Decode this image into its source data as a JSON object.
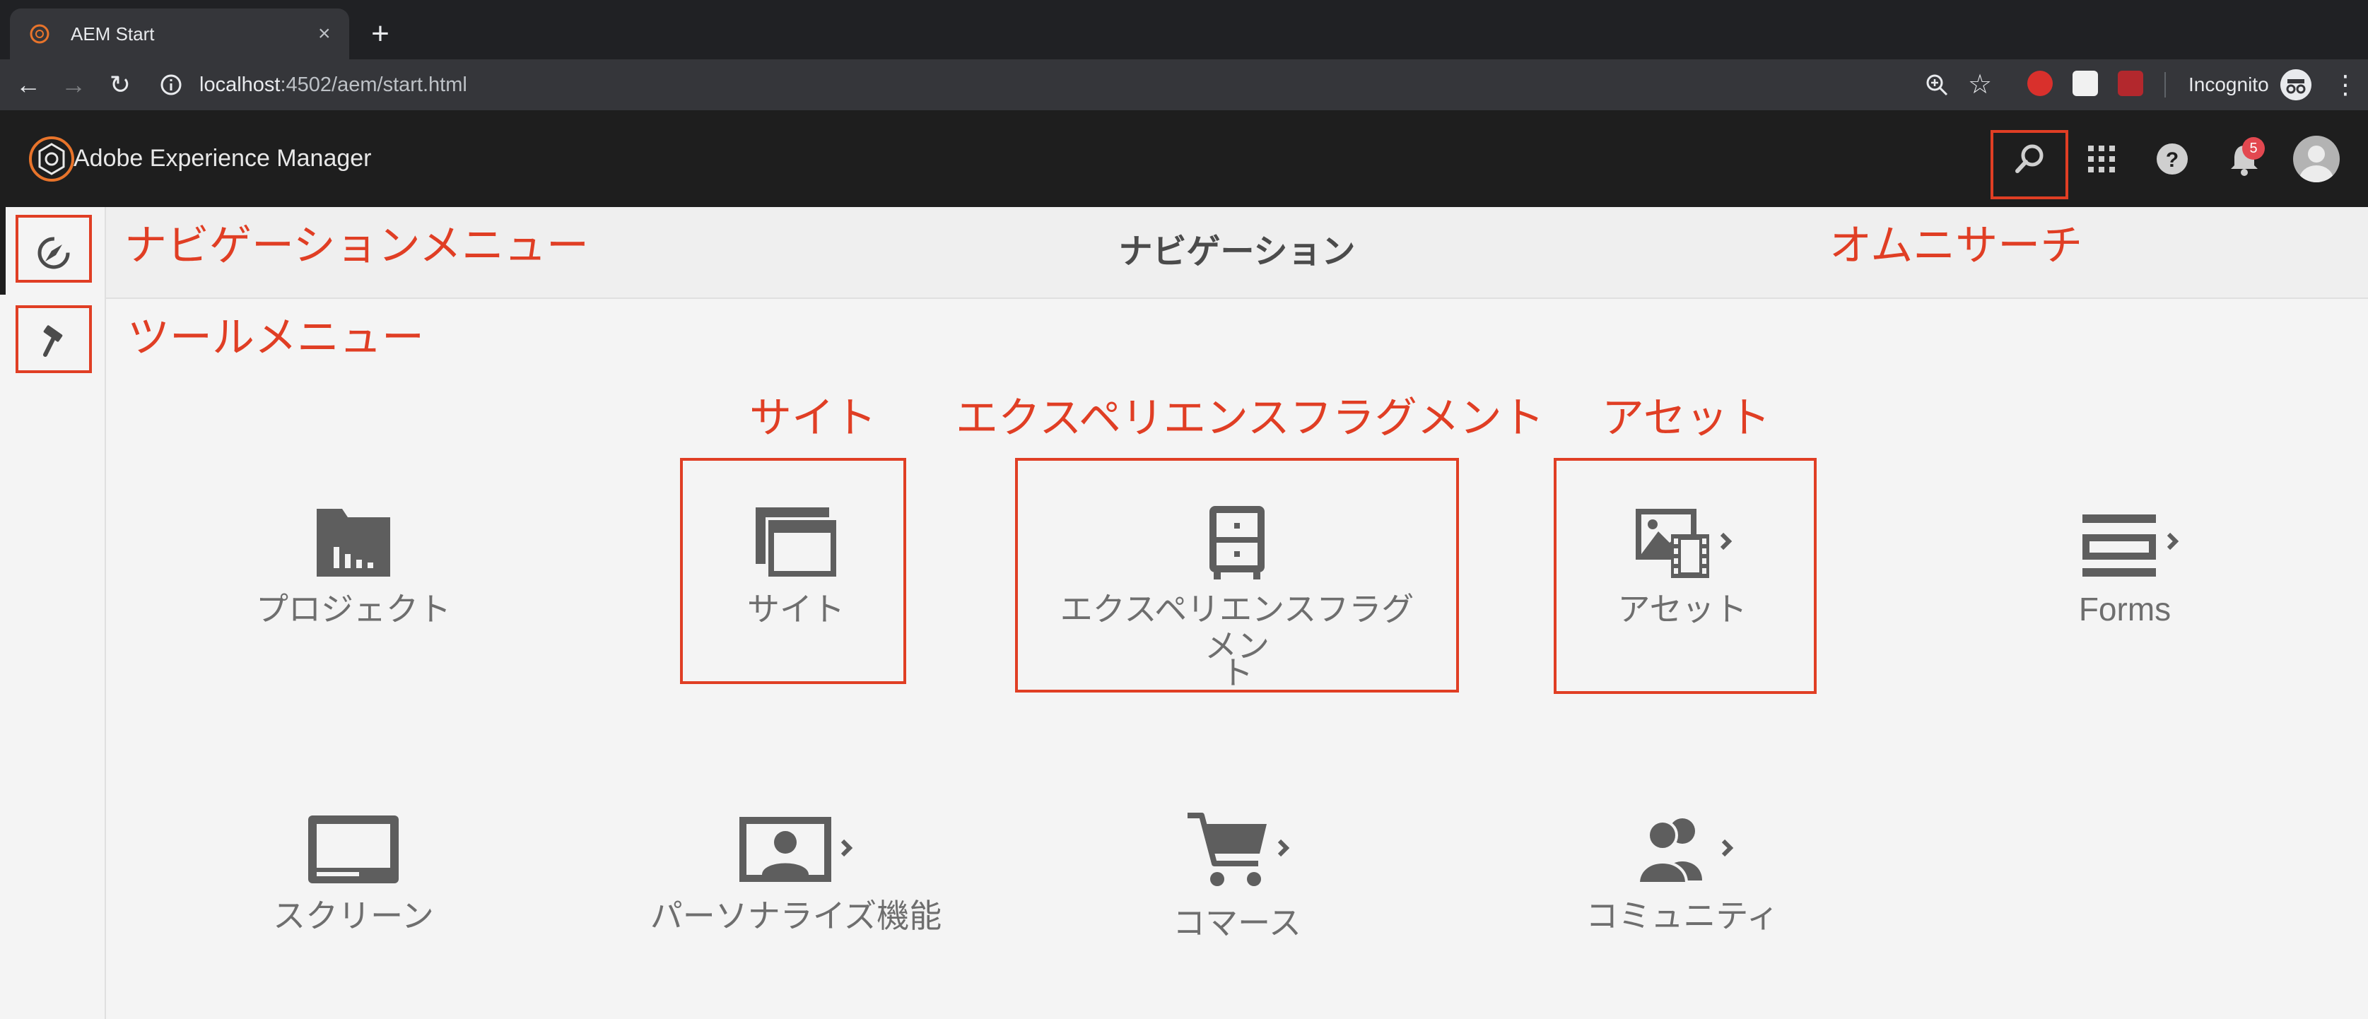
{
  "browser": {
    "tab_title": "AEM Start",
    "tab_close": "×",
    "new_tab": "+",
    "url_host": "localhost",
    "url_path": ":4502/aem/start.html",
    "incognito_label": "Incognito"
  },
  "header": {
    "app_title": "Adobe Experience Manager",
    "notification_count": "5"
  },
  "page": {
    "title": "ナビゲーション"
  },
  "annotations": {
    "nav_menu": "ナビゲーションメニュー",
    "tools_menu": "ツールメニュー",
    "omni_search": "オムニサーチ",
    "sites": "サイト",
    "experience_fragments": "エクスペリエンスフラグメント",
    "assets": "アセット"
  },
  "tiles": {
    "projects": "プロジェクト",
    "sites": "サイト",
    "xf_line1": "エクスペリエンスフラグメン",
    "xf_line2": "ト",
    "assets": "アセット",
    "forms": "Forms",
    "screens": "スクリーン",
    "personalization": "パーソナライズ機能",
    "commerce": "コマース",
    "communities": "コミュニティ"
  },
  "colors": {
    "annotation_red": "#e03e24",
    "header_bg": "#1e1e1e",
    "page_bg": "#f4f4f4",
    "icon_gray": "#5e5e5e",
    "badge_red": "#e34850"
  }
}
